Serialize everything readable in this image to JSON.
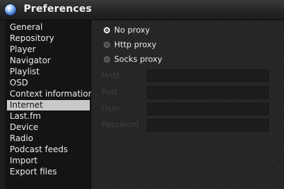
{
  "window": {
    "title": "Preferences"
  },
  "sidebar": {
    "items": [
      {
        "label": "General"
      },
      {
        "label": "Repository"
      },
      {
        "label": "Player"
      },
      {
        "label": "Navigator"
      },
      {
        "label": "Playlist"
      },
      {
        "label": "OSD"
      },
      {
        "label": "Context information"
      },
      {
        "label": "Internet",
        "selected": true
      },
      {
        "label": "Last.fm"
      },
      {
        "label": "Device"
      },
      {
        "label": "Radio"
      },
      {
        "label": "Podcast feeds"
      },
      {
        "label": "Import"
      },
      {
        "label": "Export files"
      }
    ]
  },
  "proxy": {
    "options": [
      {
        "label": "No proxy",
        "checked": true
      },
      {
        "label": "Http proxy",
        "checked": false
      },
      {
        "label": "Socks proxy",
        "checked": false
      }
    ],
    "fields": [
      {
        "label": "Host",
        "value": ""
      },
      {
        "label": "Port",
        "value": ""
      },
      {
        "label": "User",
        "value": ""
      },
      {
        "label": "Password",
        "value": ""
      }
    ]
  }
}
